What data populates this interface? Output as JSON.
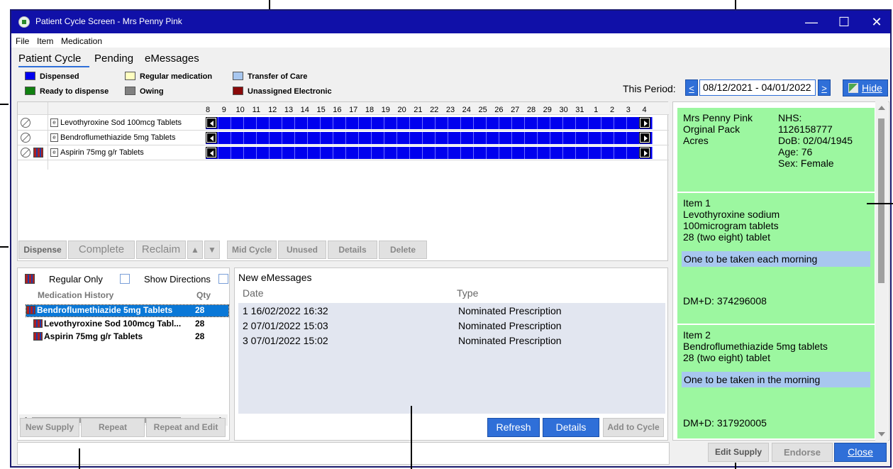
{
  "window": {
    "title": "Patient Cycle Screen - Mrs Penny Pink",
    "controls": [
      "—",
      "☐",
      "✕"
    ]
  },
  "menu": [
    "File",
    "Item",
    "Medication"
  ],
  "tabs": [
    "Patient Cycle",
    "Pending",
    "eMessages"
  ],
  "legend": [
    {
      "label": "Dispensed",
      "color": "#0000ee"
    },
    {
      "label": "Regular medication",
      "color": "#ffffc0"
    },
    {
      "label": "Transfer of Care",
      "color": "#a8c7ef"
    },
    {
      "label": "Ready to dispense",
      "color": "#108010"
    },
    {
      "label": "Owing",
      "color": "#808080"
    },
    {
      "label": "Unassigned Electronic",
      "color": "#8a0a0a"
    }
  ],
  "period": {
    "label": "This Period:",
    "prev": "<",
    "next": ">",
    "range": "08/12/2021 - 04/01/2022",
    "hide": "Hide"
  },
  "grid": {
    "days": [
      "8",
      "9",
      "10",
      "11",
      "12",
      "13",
      "14",
      "15",
      "16",
      "17",
      "18",
      "19",
      "20",
      "21",
      "22",
      "23",
      "24",
      "25",
      "26",
      "27",
      "28",
      "29",
      "30",
      "31",
      "1",
      "2",
      "3",
      "4"
    ],
    "rows": [
      {
        "name": "Levothyroxine Sod 100mcg Tablets"
      },
      {
        "name": "Bendroflumethiazide 5mg Tablets"
      },
      {
        "name": "Aspirin 75mg g/r Tablets"
      }
    ],
    "e_marker": "e"
  },
  "actions": {
    "dispense": "Dispense",
    "complete": "Complete",
    "reclaim": "Reclaim",
    "up": "▲",
    "down": "▼",
    "mid_cycle": "Mid Cycle",
    "unused": "Unused",
    "details": "Details",
    "delete": "Delete"
  },
  "history": {
    "regular_only": "Regular Only",
    "show_directions": "Show Directions",
    "col_history": "Medication History",
    "col_qty": "Qty",
    "rows": [
      {
        "name": "Bendroflumethiazide 5mg Tablets",
        "qty": "28"
      },
      {
        "name": "Levothyroxine Sod 100mcg Tabl...",
        "qty": "28"
      },
      {
        "name": "Aspirin 75mg g/r Tablets",
        "qty": "28"
      }
    ],
    "new_supply": "New Supply",
    "repeat": "Repeat",
    "repeat_edit": "Repeat and Edit"
  },
  "emessages": {
    "title": "New eMessages",
    "col_date": "Date",
    "col_type": "Type",
    "rows": [
      {
        "date": "1 16/02/2022 16:32",
        "type": "Nominated Prescription"
      },
      {
        "date": "2 07/01/2022 15:03",
        "type": "Nominated Prescription"
      },
      {
        "date": "3 07/01/2022 15:02",
        "type": "Nominated Prescription"
      }
    ],
    "refresh": "Refresh",
    "details": "Details",
    "add_to_cycle": "Add to Cycle"
  },
  "patient": {
    "name": "Mrs Penny Pink",
    "pack": "Orginal Pack",
    "town": "Acres",
    "nhs_label": "NHS:",
    "nhs": "1126158777",
    "dob": "DoB: 02/04/1945",
    "age": "Age: 76",
    "sex": "Sex: Female"
  },
  "items": [
    {
      "heading": "Item 1",
      "line1": "Levothyroxine sodium",
      "line2": "100microgram tablets",
      "line3": "28 (two eight) tablet",
      "directions": "One to be taken each morning",
      "dmd": "DM+D: 374296008"
    },
    {
      "heading": "Item 2",
      "line1": "Bendroflumethiazide 5mg tablets",
      "line2": "28 (two eight) tablet",
      "directions": "One to be taken in the morning",
      "dmd": "DM+D: 317920005"
    }
  ],
  "footer": {
    "edit_supply": "Edit Supply",
    "endorse": "Endorse",
    "close": "Close"
  }
}
